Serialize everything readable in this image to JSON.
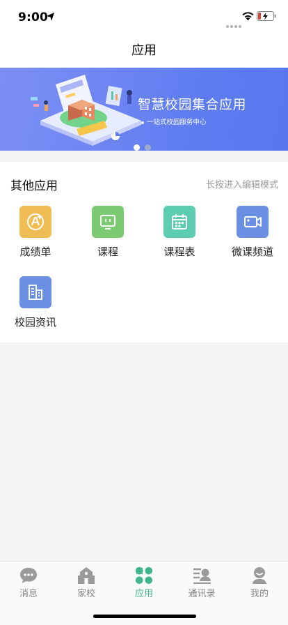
{
  "status_bar": {
    "time": "9:00"
  },
  "nav": {
    "title": "应用"
  },
  "banner": {
    "title": "智慧校园集合应用",
    "subtitle": "一站式校园服务中心",
    "slide_count": 2,
    "active_slide": 1
  },
  "apps": {
    "section_title": "其他应用",
    "hint": "长按进入编辑模式",
    "items": [
      {
        "label": "成绩单",
        "icon": "grade-icon",
        "color": "#efbd53"
      },
      {
        "label": "课程",
        "icon": "monitor-icon",
        "color": "#7ccb72"
      },
      {
        "label": "课程表",
        "icon": "calendar-icon",
        "color": "#5ccdb1"
      },
      {
        "label": "微课频道",
        "icon": "video-camera-icon",
        "color": "#6b8fe2"
      },
      {
        "label": "校园资讯",
        "icon": "news-icon",
        "color": "#6b8fe2"
      }
    ]
  },
  "tabbar": {
    "active_color": "#3fb68e",
    "inactive_color": "#888888",
    "items": [
      {
        "label": "消息",
        "icon": "chat-bubble-icon"
      },
      {
        "label": "家校",
        "icon": "school-building-icon"
      },
      {
        "label": "应用",
        "icon": "four-leaf-apps-icon",
        "active": true
      },
      {
        "label": "通讯录",
        "icon": "contacts-icon"
      },
      {
        "label": "我的",
        "icon": "profile-icon"
      }
    ]
  }
}
